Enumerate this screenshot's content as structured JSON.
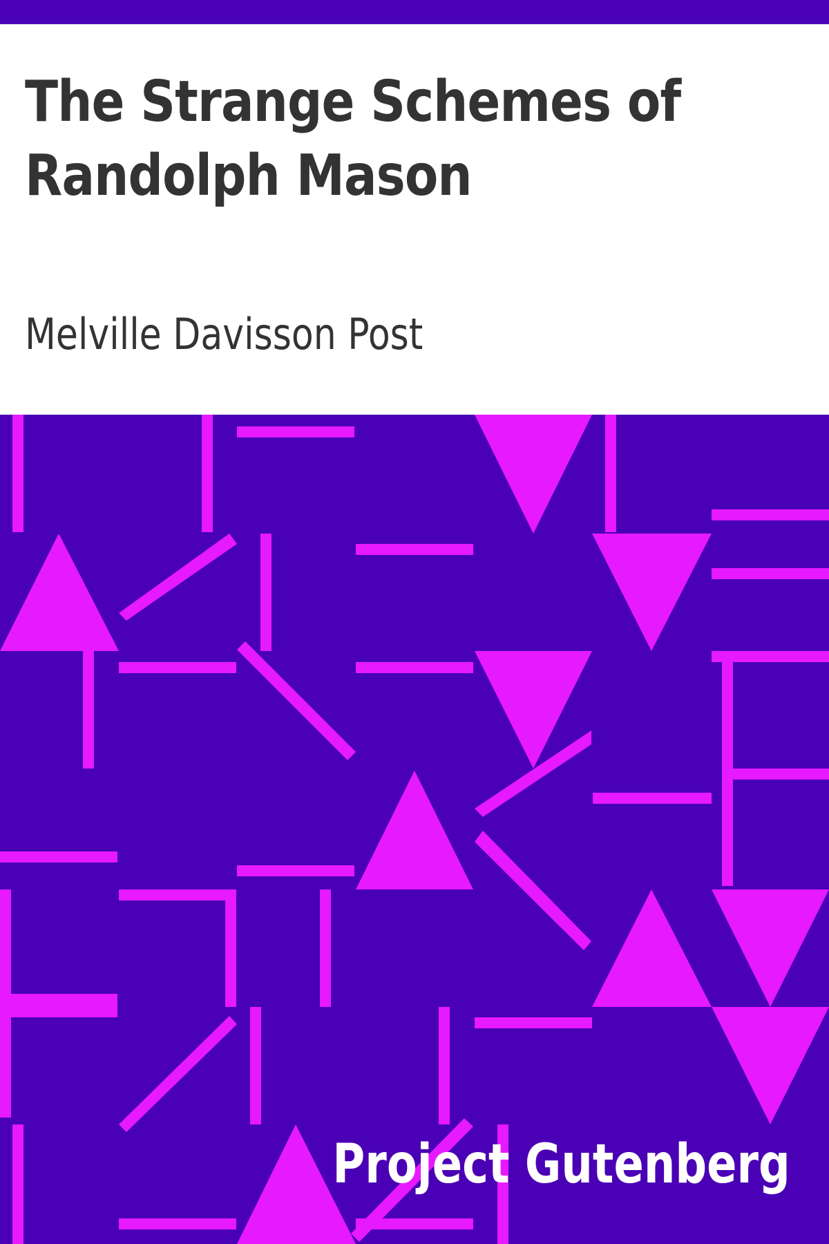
{
  "cover": {
    "title": "The Strange Schemes of Randolph Mason",
    "author": "Melville Davisson Post",
    "publisher": "Project Gutenberg"
  },
  "colors": {
    "background": "#ffffff",
    "text": "#333333",
    "band": "#4a00b4",
    "pattern": "#e619ff",
    "publisher_text": "#ffffff"
  }
}
